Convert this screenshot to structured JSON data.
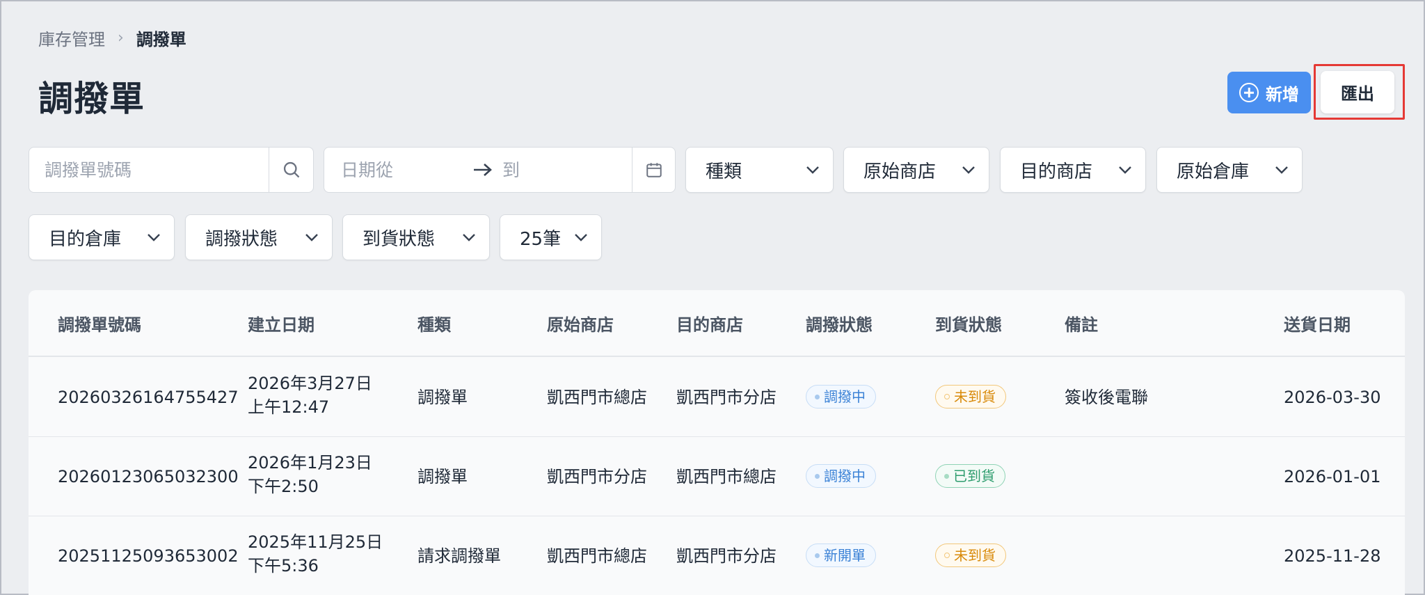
{
  "breadcrumb": {
    "parent": "庫存管理",
    "separator": "›",
    "current": "調撥單"
  },
  "page_title": "調撥單",
  "header_buttons": {
    "new_label": "新增",
    "export_label": "匯出"
  },
  "filters": {
    "search_placeholder": "調撥單號碼",
    "date_from_placeholder": "日期從",
    "date_to_placeholder": "到",
    "dropdowns": [
      "種類",
      "原始商店",
      "目的商店",
      "原始倉庫",
      "目的倉庫",
      "調撥狀態",
      "到貨狀態",
      "25筆"
    ]
  },
  "table": {
    "headers": [
      "調撥單號碼",
      "建立日期",
      "種類",
      "原始商店",
      "目的商店",
      "調撥狀態",
      "到貨狀態",
      "備註",
      "送貨日期"
    ],
    "rows": [
      {
        "number": "20260326164755427",
        "created_date": "2026年3月27日",
        "created_time": "上午12:47",
        "type": "調撥單",
        "source_store": "凱西門市總店",
        "dest_store": "凱西門市分店",
        "transfer_status": "調撥中",
        "arrival_status": "未到貨",
        "note": "簽收後電聯",
        "delivery_date": "2026-03-30"
      },
      {
        "number": "20260123065032300",
        "created_date": "2026年1月23日",
        "created_time": "下午2:50",
        "type": "調撥單",
        "source_store": "凱西門市分店",
        "dest_store": "凱西門市總店",
        "transfer_status": "調撥中",
        "arrival_status": "已到貨",
        "note": "",
        "delivery_date": "2026-01-01"
      },
      {
        "number": "20251125093653002",
        "created_date": "2025年11月25日",
        "created_time": "下午5:36",
        "type": "請求調撥單",
        "source_store": "凱西門市總店",
        "dest_store": "凱西門市分店",
        "transfer_status": "新開單",
        "arrival_status": "未到貨",
        "note": "",
        "delivery_date": "2025-11-28"
      }
    ]
  },
  "colors": {
    "primary": "#4a8ff0",
    "highlight": "#e53935",
    "status_blue": "#3b82d6",
    "status_orange": "#d88a0a",
    "status_green": "#2e9d6e"
  },
  "icons": [
    "plus-circle-icon",
    "search-icon",
    "arrow-right-icon",
    "calendar-icon",
    "chevron-down-icon"
  ]
}
